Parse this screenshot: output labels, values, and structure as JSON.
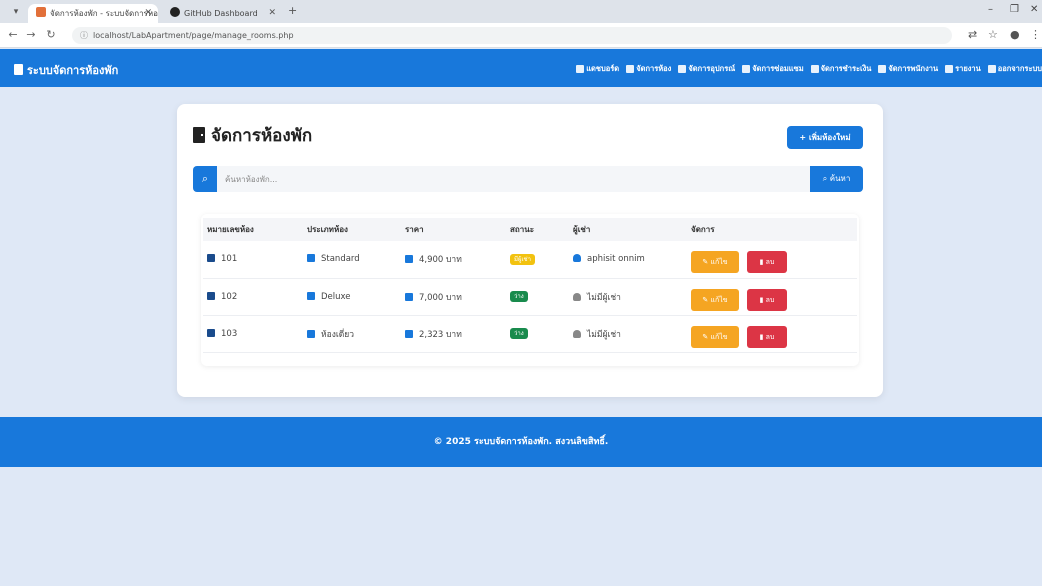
{
  "browser": {
    "tabs": [
      {
        "title": "จัดการห้องพัก - ระบบจัดการหอพัก",
        "active": true
      },
      {
        "title": "GitHub Dashboard",
        "active": false
      }
    ],
    "url": "localhost/LabApartment/page/manage_rooms.php"
  },
  "navbar": {
    "brand": "ระบบจัดการห้องพัก",
    "menu": [
      {
        "label": "แดชบอร์ด",
        "icon": "chart-icon"
      },
      {
        "label": "จัดการห้อง",
        "icon": "door-icon"
      },
      {
        "label": "จัดการอุปกรณ์",
        "icon": "tools-icon"
      },
      {
        "label": "จัดการซ่อมแซม",
        "icon": "wrench-icon"
      },
      {
        "label": "จัดการชำระเงิน",
        "icon": "money-icon"
      },
      {
        "label": "จัดการพนักงาน",
        "icon": "users-icon"
      },
      {
        "label": "รายงาน",
        "icon": "report-icon"
      },
      {
        "label": "ออกจากระบบ",
        "icon": "logout-icon"
      }
    ]
  },
  "page": {
    "title": "จัดการห้องพัก",
    "add_button": "+ เพิ่มห้องใหม่",
    "search_placeholder": "ค้นหาห้องพัก...",
    "search_button": "ค้นหา"
  },
  "table": {
    "headers": [
      "หมายเลขห้อง",
      "ประเภทห้อง",
      "ราคา",
      "สถานะ",
      "ผู้เช่า",
      "จัดการ"
    ],
    "rows": [
      {
        "room": "101",
        "type": "Standard",
        "price": "4,900 บาท",
        "status": "มีผู้เช่า",
        "status_kind": "occupied",
        "tenant": "aphisit onnim",
        "has_tenant": true
      },
      {
        "room": "102",
        "type": "Deluxe",
        "price": "7,000 บาท",
        "status": "ว่าง",
        "status_kind": "vacant",
        "tenant": "ไม่มีผู้เช่า",
        "has_tenant": false
      },
      {
        "room": "103",
        "type": "ห้องเดี่ยว",
        "price": "2,323 บาท",
        "status": "ว่าง",
        "status_kind": "vacant",
        "tenant": "ไม่มีผู้เช่า",
        "has_tenant": false
      }
    ],
    "edit_label": "แก้ไข",
    "delete_label": "ลบ"
  },
  "footer": {
    "text": "© 2025 ระบบจัดการห้องพัก. สงวนลิขสิทธิ์."
  },
  "colors": {
    "primary": "#1878db",
    "edit": "#f5a522",
    "delete": "#dc3545",
    "occupied": "#f2c20f",
    "vacant": "#198b4d"
  }
}
